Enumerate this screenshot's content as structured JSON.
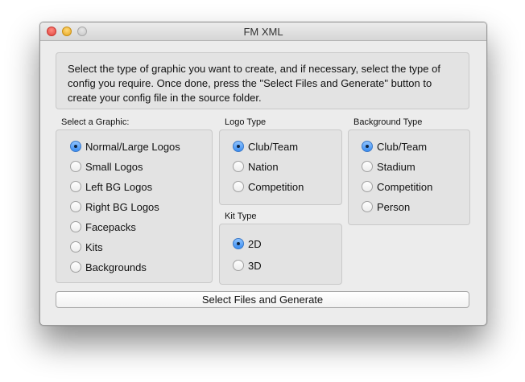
{
  "window": {
    "title": "FM XML"
  },
  "description": "Select the type of graphic you want to create, and if necessary, select the type of config you require. Once done, press the \"Select Files and Generate\" button to create your config file in the source folder.",
  "graphic_group": {
    "label": "Select a Graphic:",
    "selected": "Normal/Large Logos",
    "options": [
      "Normal/Large Logos",
      "Small Logos",
      "Left BG Logos",
      "Right BG Logos",
      "Facepacks",
      "Kits",
      "Backgrounds"
    ]
  },
  "logo_type_group": {
    "label": "Logo Type",
    "selected": "Club/Team",
    "options": [
      "Club/Team",
      "Nation",
      "Competition"
    ]
  },
  "kit_type_group": {
    "label": "Kit Type",
    "selected": "2D",
    "options": [
      "2D",
      "3D"
    ]
  },
  "background_type_group": {
    "label": "Background Type",
    "selected": "Club/Team",
    "options": [
      "Club/Team",
      "Stadium",
      "Competition",
      "Person"
    ]
  },
  "generate_button": {
    "label": "Select Files and Generate"
  }
}
